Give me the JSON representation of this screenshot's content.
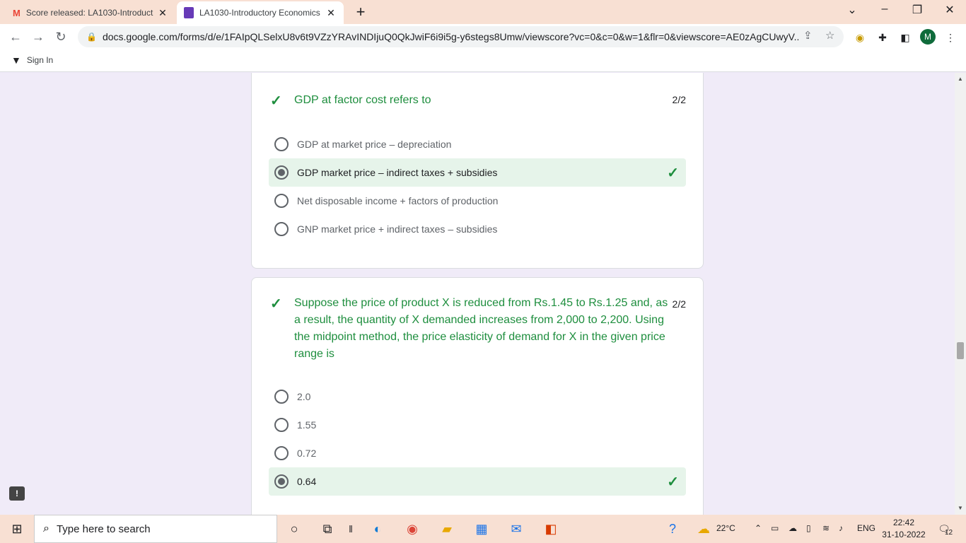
{
  "browser": {
    "tabs": [
      {
        "title": "Score released: LA1030-Introduct",
        "icon": "gmail-icon",
        "active": false
      },
      {
        "title": "LA1030-Introductory Economics",
        "icon": "forms-icon",
        "active": true
      }
    ],
    "url": "docs.google.com/forms/d/e/1FAIpQLSelxU8v6t9VZzYRAvINDIjuQ0QkJwiF6i9i5g-y6stegs8Umw/viewscore?vc=0&c=0&w=1&flr=0&viewscore=AE0zAgCUwyV...",
    "avatar_letter": "M",
    "bookmark_label": "Sign In"
  },
  "questions": [
    {
      "text": "GDP at factor cost refers to",
      "score": "2/2",
      "options": [
        {
          "label": "GDP at market price – depreciation",
          "selected": false,
          "correct": false
        },
        {
          "label": "GDP market price – indirect taxes + subsidies",
          "selected": true,
          "correct": true
        },
        {
          "label": "Net disposable income + factors of production",
          "selected": false,
          "correct": false
        },
        {
          "label": "GNP market price + indirect taxes – subsidies",
          "selected": false,
          "correct": false
        }
      ]
    },
    {
      "text": "Suppose the price of product X is reduced from Rs.1.45 to Rs.1.25 and, as a result, the quantity of X demanded increases from 2,000 to 2,200. Using the midpoint method, the price elasticity of demand for X in the given price range is",
      "score": "2/2",
      "options": [
        {
          "label": "2.0",
          "selected": false,
          "correct": false
        },
        {
          "label": "1.55",
          "selected": false,
          "correct": false
        },
        {
          "label": "0.72",
          "selected": false,
          "correct": false
        },
        {
          "label": "0.64",
          "selected": true,
          "correct": true
        }
      ]
    }
  ],
  "taskbar": {
    "search_placeholder": "Type here to search",
    "weather": "22°C",
    "language": "ENG",
    "time": "22:42",
    "date": "31-10-2022",
    "notifications": "12"
  },
  "colors": {
    "accent_green": "#1e8e3e",
    "correct_bg": "#e6f4ea",
    "page_bg": "#f0ebf8",
    "titlebar_bg": "#f8e0d3"
  }
}
